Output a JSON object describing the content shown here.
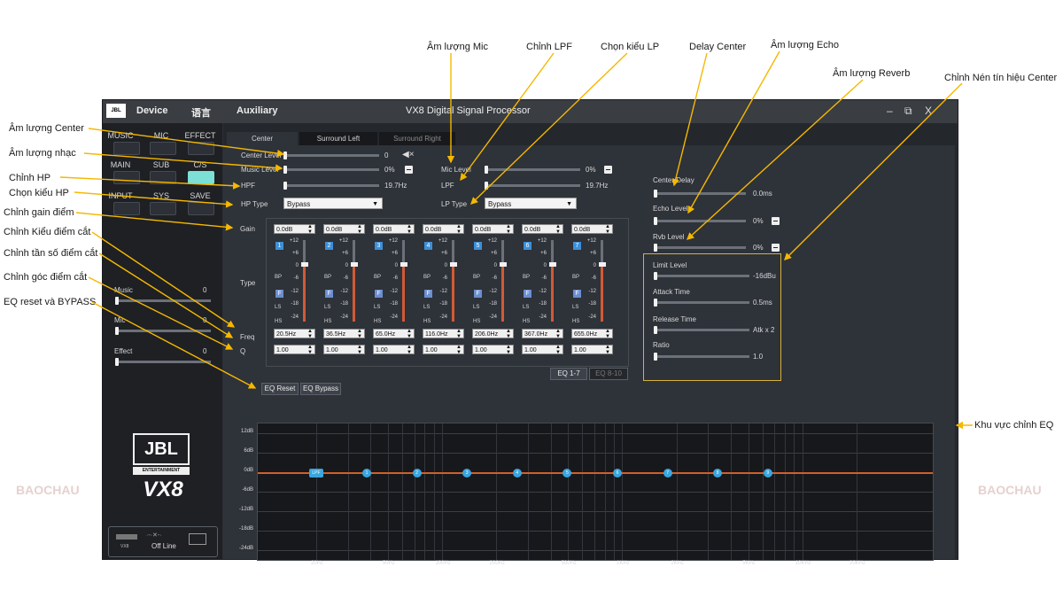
{
  "annotations": {
    "am_luong_center": "Âm lượng Center",
    "am_luong_nhac": "Âm lượng nhạc",
    "chinh_hp": "Chỉnh HP",
    "chon_kieu_hp": "Chọn kiểu HP",
    "chinh_gain": "Chỉnh gain điểm",
    "chinh_kieu_diem_cat": "Chỉnh Kiểu điểm cắt",
    "chinh_tan_so": "Chỉnh tần số điểm cắt",
    "chinh_goc": "Chỉnh góc điểm cắt",
    "eq_reset_bypass": "EQ reset và BYPASS",
    "am_luong_mic": "Âm lượng Mic",
    "chinh_lpf": "Chỉnh LPF",
    "chon_kieu_lp": "Chọn kiểu LP",
    "delay_center": "Delay Center",
    "am_luong_echo": "Âm lượng Echo",
    "am_luong_reverb": "Âm lượng Reverb",
    "chinh_nen": "Chỉnh Nén tín hiệu Center",
    "khu_vuc_eq": "Khu vực chỉnh EQ"
  },
  "window": {
    "logo_text": "JBL",
    "menu_device": "Device",
    "menu_lang": "语言",
    "menu_aux": "Auxiliary",
    "title": "VX8  Digital Signal Processor",
    "min": "–",
    "restore": "⧉",
    "close": "X"
  },
  "left": {
    "modes": [
      "MUSIC",
      "MIC",
      "EFFECT",
      "MAIN",
      "SUB",
      "C/S",
      "INPUT",
      "SYS",
      "SAVE"
    ],
    "active_mode": "C/S",
    "music_label": "Music",
    "music_value": "0",
    "mic_label": "Mic",
    "mic_value": "0",
    "effect_label": "Effect",
    "effect_value": "0",
    "logo_main": "JBL",
    "logo_sub": "ENTERTAINMENT",
    "model": "VX8",
    "device_label": "VX8",
    "status": "Off Line"
  },
  "tabs": [
    "Center",
    "Surround Left",
    "Surround Right"
  ],
  "active_tab": "Center",
  "center": {
    "center_level_label": "Center Level",
    "center_level_value": "0",
    "music_level_label": "Music Level",
    "music_level_value": "0%",
    "hpf_label": "HPF",
    "hpf_value": "19.7Hz",
    "hp_type_label": "HP Type",
    "hp_type_value": "Bypass",
    "mic_level_label": "Mic Level",
    "mic_level_value": "0%",
    "lpf_label": "LPF",
    "lpf_value": "19.7Hz",
    "lp_type_label": "LP Type",
    "lp_type_value": "Bypass",
    "gain_label": "Gain",
    "type_label": "Type",
    "freq_label": "Freq",
    "q_label": "Q"
  },
  "eq_channels": [
    {
      "num": "1",
      "gain": "0.0dB",
      "freq": "20.5Hz",
      "q": "1.00"
    },
    {
      "num": "2",
      "gain": "0.0dB",
      "freq": "36.5Hz",
      "q": "1.00"
    },
    {
      "num": "3",
      "gain": "0.0dB",
      "freq": "65.0Hz",
      "q": "1.00"
    },
    {
      "num": "4",
      "gain": "0.0dB",
      "freq": "116.0Hz",
      "q": "1.00"
    },
    {
      "num": "5",
      "gain": "0.0dB",
      "freq": "206.0Hz",
      "q": "1.00"
    },
    {
      "num": "6",
      "gain": "0.0dB",
      "freq": "367.0Hz",
      "q": "1.00"
    },
    {
      "num": "7",
      "gain": "0.0dB",
      "freq": "655.0Hz",
      "q": "1.00"
    }
  ],
  "eq_scale": [
    "+12",
    "+6",
    "0",
    "-6",
    "-12",
    "-18",
    "-24"
  ],
  "eq_types": [
    "BP",
    "F",
    "LS",
    "HS"
  ],
  "eq_pages": [
    "EQ 1-7",
    "EQ 8-10"
  ],
  "active_eq_page": "EQ 1-7",
  "eq_reset": "EQ Reset",
  "eq_bypass": "EQ Bypass",
  "effects": {
    "center_delay_label": "Center Delay",
    "center_delay_value": "0.0ms",
    "echo_level_label": "Echo Level",
    "echo_level_value": "0%",
    "rvb_level_label": "Rvb Level",
    "rvb_level_value": "0%"
  },
  "compressor": {
    "limit_label": "Limit Level",
    "limit_value": "-16dBu",
    "attack_label": "Attack Time",
    "attack_value": "0.5ms",
    "release_label": "Release Time",
    "release_value": "Atk x 2",
    "ratio_label": "Ratio",
    "ratio_value": "1.0"
  },
  "graph": {
    "y_labels": [
      "12dB",
      "6dB",
      "0dB",
      "-6dB",
      "-12dB",
      "-18dB",
      "-24dB"
    ],
    "x_labels": [
      "20Hz",
      "50Hz",
      "100Hz",
      "200Hz",
      "500Hz",
      "1KHz",
      "2KHz",
      "5KHz",
      "10KHz",
      "20KHz"
    ],
    "nodes": [
      "LPF",
      "1",
      "2",
      "3",
      "4",
      "5",
      "6",
      "7",
      "8",
      "9"
    ]
  },
  "watermark": "BAOCHAU",
  "colors": {
    "accent": "#7ce0d6",
    "curve": "#d2602a",
    "node": "#39a6e0",
    "arrow": "#f5b800"
  }
}
